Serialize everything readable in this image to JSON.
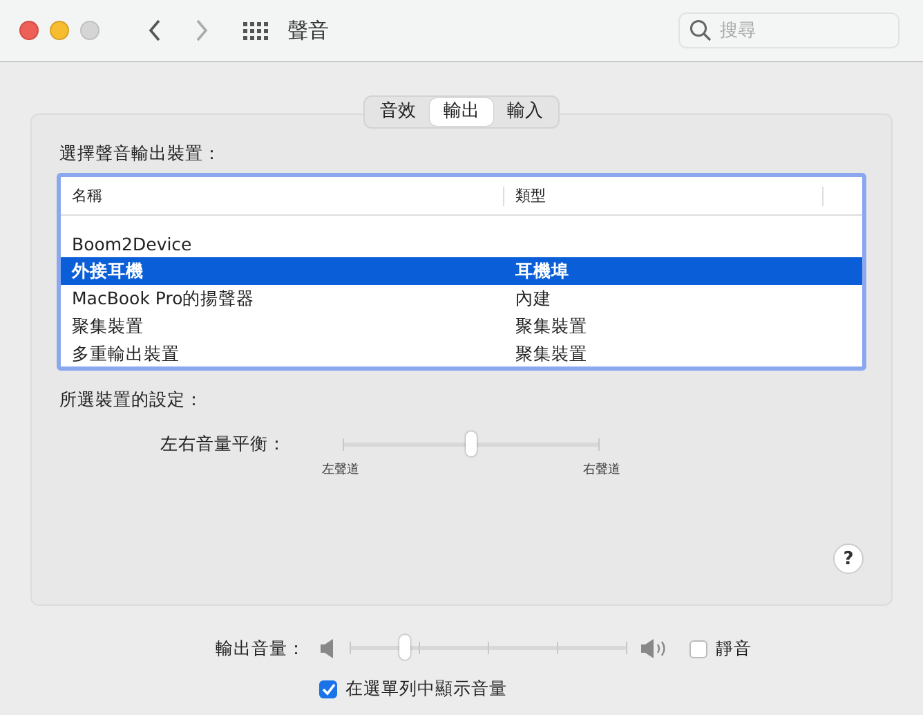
{
  "window": {
    "title": "聲音",
    "search": {
      "placeholder": "搜尋"
    }
  },
  "tabs": [
    {
      "label": "音效",
      "selected": false
    },
    {
      "label": "輸出",
      "selected": true
    },
    {
      "label": "輸入",
      "selected": false
    }
  ],
  "device_list": {
    "heading": "選擇聲音輸出裝置：",
    "columns": [
      "名稱",
      "類型"
    ],
    "rows": [
      {
        "name": "Boom2Device",
        "selected": false
      },
      {
        "name": "外接耳機",
        "type": "耳機埠",
        "selected": true
      },
      {
        "name": "MacBook Pro的揚聲器",
        "type": "內建",
        "selected": false
      },
      {
        "name": "聚集裝置",
        "type": "聚集裝置",
        "selected": false
      },
      {
        "name": "多重輸出裝置",
        "type": "聚集裝置",
        "selected": false
      }
    ]
  },
  "settings": {
    "heading": "所選裝置的設定：",
    "balance": {
      "label": "左右音量平衡：",
      "level": 0.5,
      "left_label": "左聲道",
      "right_label": "右聲道"
    }
  },
  "output_volume": {
    "label": "輸出音量：",
    "level": 0.2,
    "mute": {
      "label": "靜音",
      "checked": false
    }
  },
  "help": {
    "label": "?"
  },
  "show_in_menu_bar": {
    "label": "在選單列中顯示音量",
    "checked": true
  }
}
